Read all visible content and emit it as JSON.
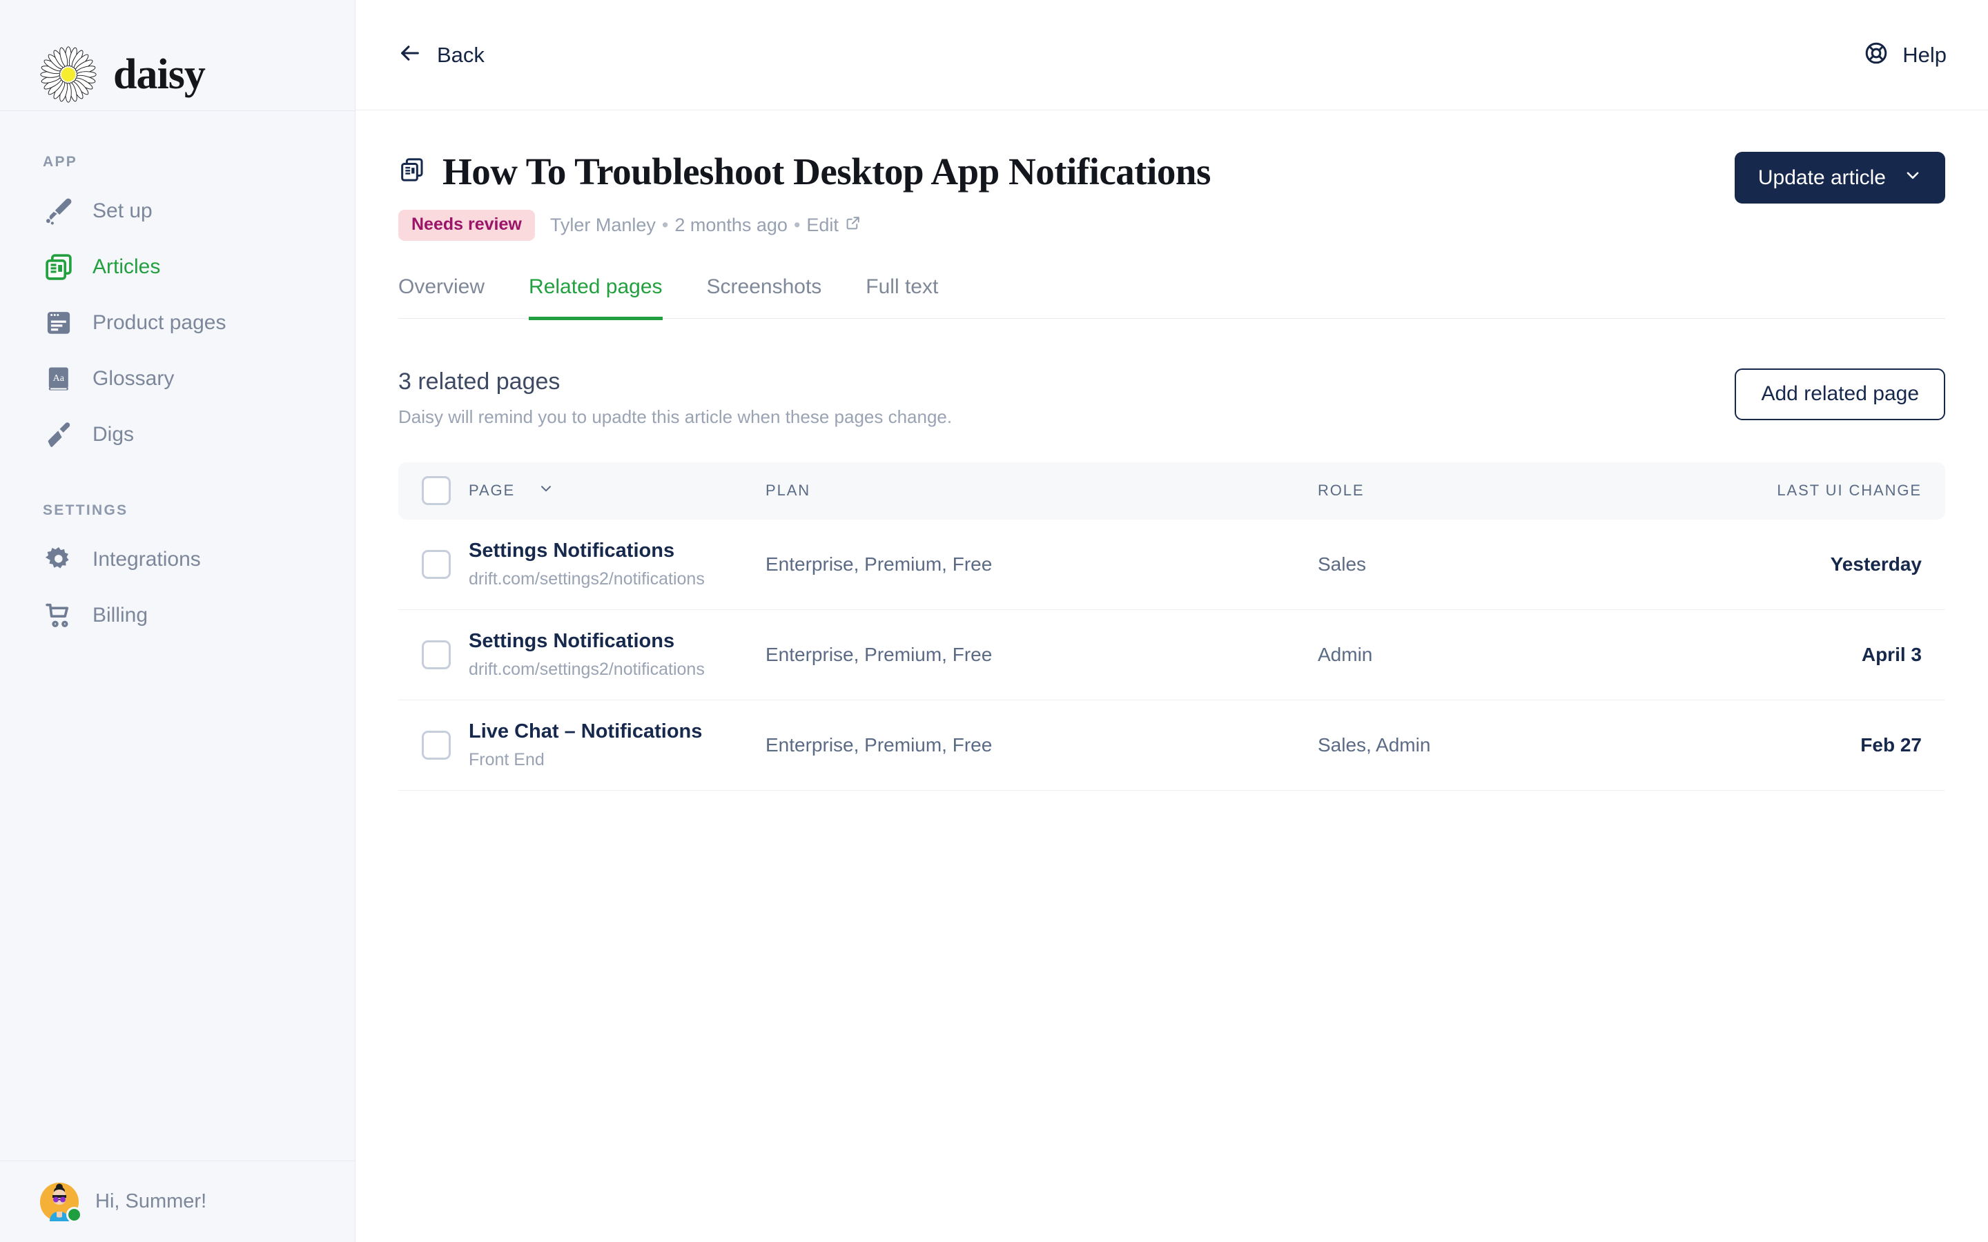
{
  "brand": {
    "name": "daisy",
    "logo_icon": "daisy-flower-icon",
    "petal_color": "#ffffff",
    "center_color": "#f7ed2f"
  },
  "sidebar": {
    "sections": [
      {
        "label": "APP",
        "items": [
          {
            "label": "Set up",
            "icon": "eraser-icon",
            "active": false
          },
          {
            "label": "Articles",
            "icon": "articles-stack-icon",
            "active": true
          },
          {
            "label": "Product pages",
            "icon": "browser-window-icon",
            "active": false
          },
          {
            "label": "Glossary",
            "icon": "book-aa-icon",
            "active": false
          },
          {
            "label": "Digs",
            "icon": "trowel-icon",
            "active": false
          }
        ]
      },
      {
        "label": "SETTINGS",
        "items": [
          {
            "label": "Integrations",
            "icon": "gear-icon",
            "active": false
          },
          {
            "label": "Billing",
            "icon": "shopping-cart-icon",
            "active": false
          }
        ]
      }
    ],
    "user": {
      "greeting": "Hi, Summer!",
      "status": "online",
      "avatar_icon": "user-avatar-icon"
    }
  },
  "topbar": {
    "back_label": "Back",
    "back_icon": "arrow-left-icon",
    "help_label": "Help",
    "help_icon": "lifebuoy-icon"
  },
  "article": {
    "title": "How To Troubleshoot Desktop App Notifications",
    "title_icon": "article-document-icon",
    "status_badge": "Needs review",
    "author": "Tyler Manley",
    "updated": "2 months ago",
    "edit_label": "Edit",
    "edit_icon": "external-link-icon",
    "separator": "•",
    "primary_action": "Update article",
    "primary_action_icon": "chevron-down-icon"
  },
  "tabs": [
    {
      "label": "Overview",
      "active": false
    },
    {
      "label": "Related pages",
      "active": true
    },
    {
      "label": "Screenshots",
      "active": false
    },
    {
      "label": "Full text",
      "active": false
    }
  ],
  "related": {
    "heading": "3 related pages",
    "subheading": "Daisy will remind you to upadte this article when these pages change.",
    "add_button": "Add related page",
    "columns": {
      "page": "PAGE",
      "page_sort_icon": "chevron-down-icon",
      "plan": "PLAN",
      "role": "ROLE",
      "last_ui_change": "LAST UI CHANGE"
    },
    "rows": [
      {
        "title": "Settings Notifications",
        "subtitle": "drift.com/settings2/notifications",
        "plan": "Enterprise, Premium, Free",
        "role": "Sales",
        "last_ui_change": "Yesterday",
        "checked": false
      },
      {
        "title": "Settings Notifications",
        "subtitle": "drift.com/settings2/notifications",
        "plan": "Enterprise, Premium, Free",
        "role": "Admin",
        "last_ui_change": "April 3",
        "checked": false
      },
      {
        "title": "Live Chat – Notifications",
        "subtitle": "Front End",
        "plan": "Enterprise, Premium, Free",
        "role": "Sales, Admin",
        "last_ui_change": "Feb 27",
        "checked": false
      }
    ]
  },
  "colors": {
    "accent_green": "#22a03f",
    "navy": "#16294d",
    "badge_bg": "#fbdade",
    "badge_text": "#9c1468",
    "sidebar_bg": "#f5f7fa",
    "muted_text": "#7c879b"
  }
}
